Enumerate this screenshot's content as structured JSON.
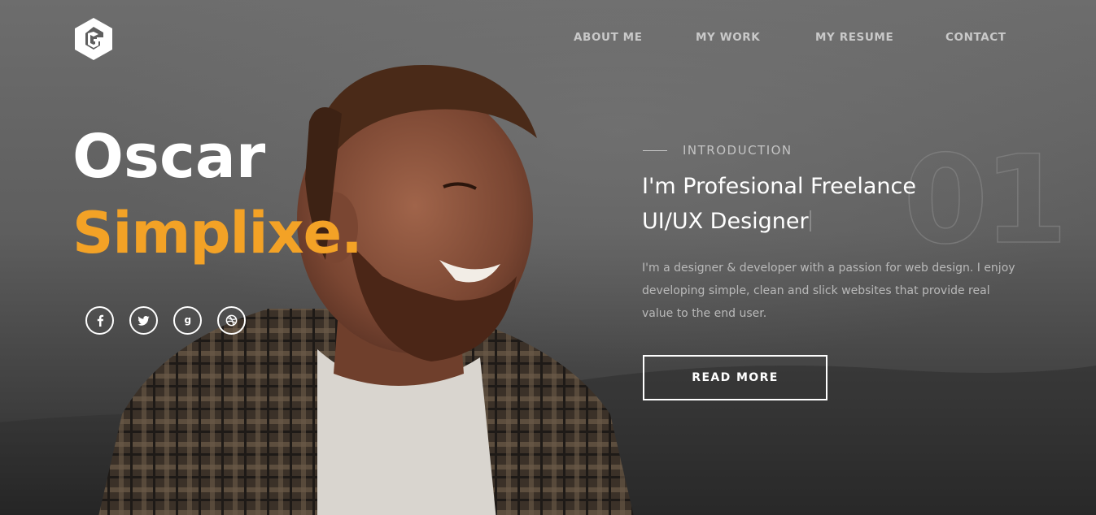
{
  "nav": {
    "items": [
      {
        "label": "ABOUT ME"
      },
      {
        "label": "MY WORK"
      },
      {
        "label": "MY RESUME"
      },
      {
        "label": "CONTACT"
      }
    ]
  },
  "hero": {
    "first_name": "Oscar",
    "last_name": "Simplixe.",
    "socials": [
      {
        "icon": "facebook-icon",
        "glyph": "f"
      },
      {
        "icon": "twitter-icon",
        "glyph": "🐦"
      },
      {
        "icon": "google-icon",
        "glyph": "g"
      },
      {
        "icon": "dribbble-icon",
        "glyph": "◎"
      }
    ]
  },
  "intro": {
    "label": "INTRODUCTION",
    "number": "01",
    "headline_line1": "I'm Profesional Freelance",
    "headline_line2": "UI/UX Designer",
    "description": "I'm a designer & developer with a passion for web design. I enjoy developing simple, clean and slick websites that provide real value to the end user.",
    "button_label": "READ MORE"
  },
  "colors": {
    "accent": "#f3a226",
    "text_primary": "#ffffff",
    "text_muted": "#b9b9b9",
    "background": "#5e5e5e"
  }
}
